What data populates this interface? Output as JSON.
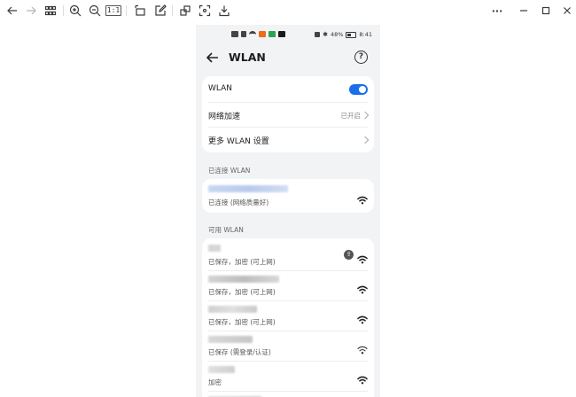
{
  "viewer": {
    "toolbar_left_icons": [
      "back-arrow-icon",
      "forward-arrow-icon",
      "grid-icon",
      "zoom-in-icon",
      "zoom-out-icon",
      "actual-size-icon",
      "rotate-icon",
      "edit-icon",
      "crop-icon",
      "fullscreen-icon",
      "download-icon"
    ],
    "actual_size_label": "1:1",
    "window_icons": [
      "more-icon",
      "minimize-icon",
      "maximize-icon",
      "close-icon"
    ],
    "more_label": "···"
  },
  "status_bar": {
    "battery": "48%",
    "time": "8:41"
  },
  "header": {
    "title": "WLAN",
    "help": "?"
  },
  "settings": {
    "wlan_label": "WLAN",
    "wlan_on": true,
    "accel_label": "网络加速",
    "accel_value": "已开启",
    "more_label": "更多 WLAN 设置"
  },
  "connected": {
    "section_title": "已连接 WLAN",
    "status": "已连接 (网络质量好)"
  },
  "available": {
    "section_title": "可用 WLAN",
    "networks": [
      {
        "status": "已保存，加密 (可上网)",
        "share": "⇪"
      },
      {
        "status": "已保存，加密 (可上网)"
      },
      {
        "status": "已保存，加密 (可上网)"
      },
      {
        "status": "已保存 (需登录/认证)"
      },
      {
        "status": "加密"
      }
    ]
  },
  "colors": {
    "accent": "#1a6fe8",
    "screen_bg": "#f1f3f5"
  }
}
